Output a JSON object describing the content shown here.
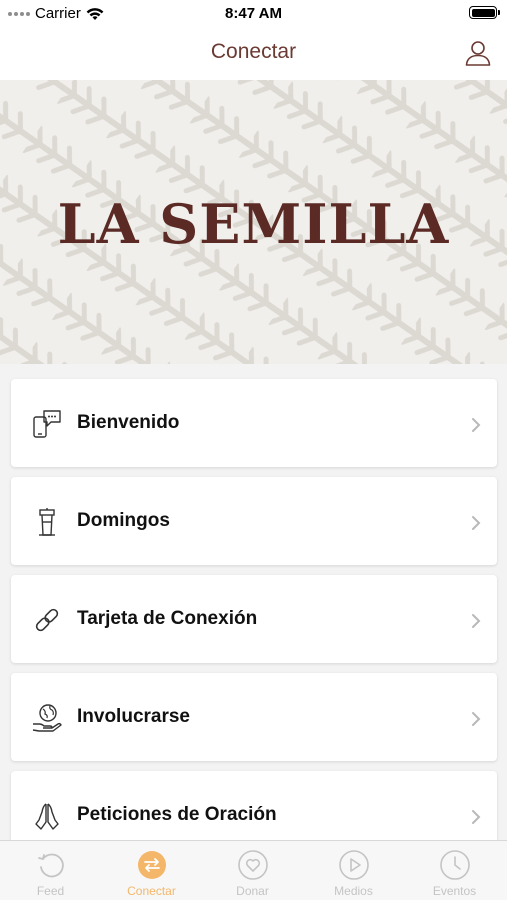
{
  "status_bar": {
    "carrier": "Carrier",
    "time": "8:47 AM"
  },
  "nav": {
    "title": "Conectar",
    "profile_icon": "person-icon"
  },
  "hero": {
    "logo_text": "LA SEMILLA"
  },
  "menu": [
    {
      "label": "Bienvenido",
      "icon": "phone-chat-icon"
    },
    {
      "label": "Domingos",
      "icon": "pulpit-icon"
    },
    {
      "label": "Tarjeta de Conexión",
      "icon": "link-icon"
    },
    {
      "label": "Involucrarse",
      "icon": "globe-hand-icon"
    },
    {
      "label": "Peticiones de Oración",
      "icon": "praying-hands-icon"
    }
  ],
  "tabs": [
    {
      "label": "Feed",
      "icon": "feed-icon",
      "active": false
    },
    {
      "label": "Conectar",
      "icon": "connect-icon",
      "active": true
    },
    {
      "label": "Donar",
      "icon": "heart-icon",
      "active": false
    },
    {
      "label": "Medios",
      "icon": "play-icon",
      "active": false
    },
    {
      "label": "Eventos",
      "icon": "clock-icon",
      "active": false
    }
  ],
  "colors": {
    "brand": "#5b2a25",
    "nav_title": "#6a3a33",
    "tab_active": "#f4b76a",
    "tab_inactive": "#c4c4c4"
  }
}
